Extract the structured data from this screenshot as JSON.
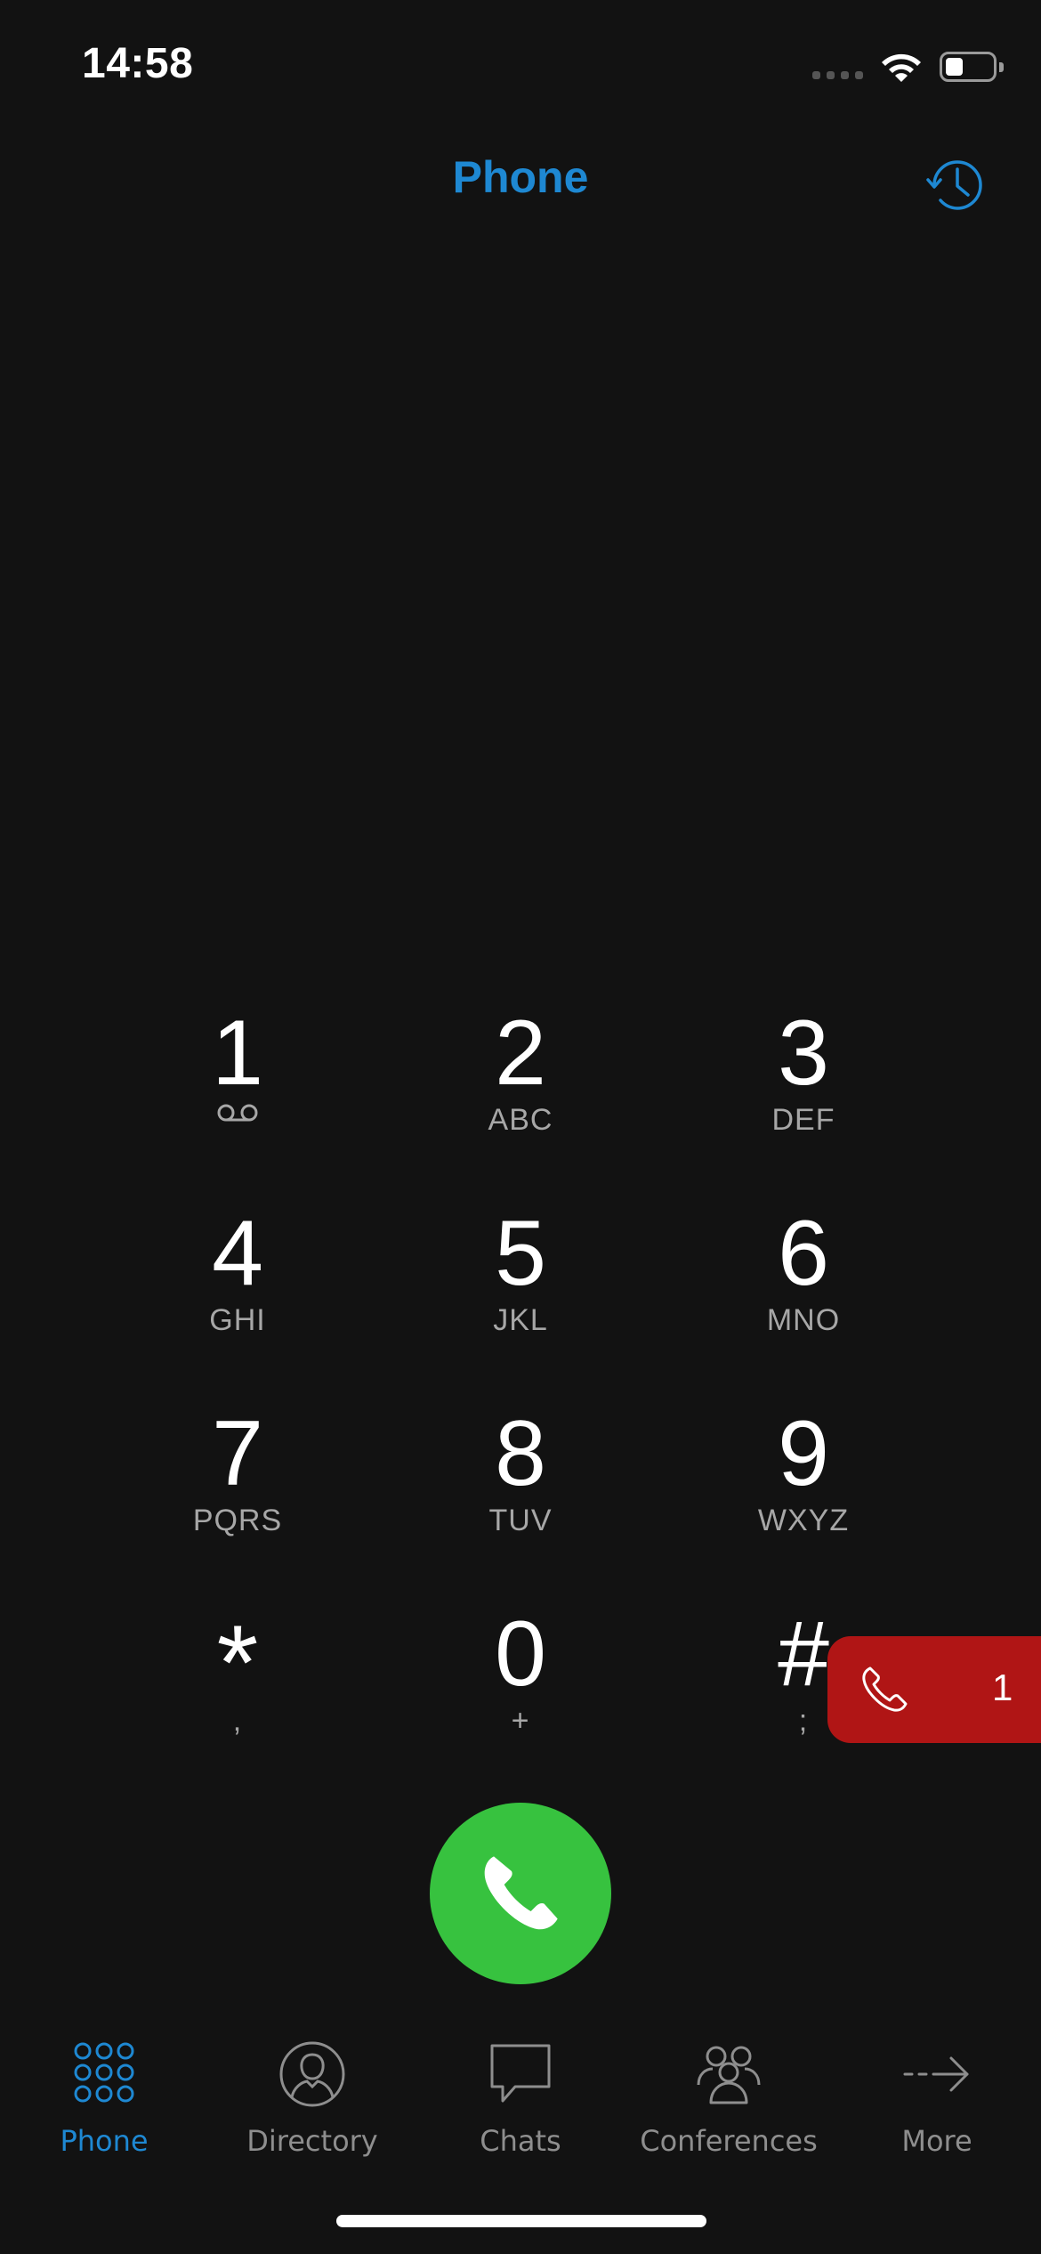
{
  "status_bar": {
    "time": "14:58"
  },
  "header": {
    "title": "Phone"
  },
  "keypad": [
    {
      "digit": "1",
      "sub": ""
    },
    {
      "digit": "2",
      "sub": "ABC"
    },
    {
      "digit": "3",
      "sub": "DEF"
    },
    {
      "digit": "4",
      "sub": "GHI"
    },
    {
      "digit": "5",
      "sub": "JKL"
    },
    {
      "digit": "6",
      "sub": "MNO"
    },
    {
      "digit": "7",
      "sub": "PQRS"
    },
    {
      "digit": "8",
      "sub": "TUV"
    },
    {
      "digit": "9",
      "sub": "WXYZ"
    },
    {
      "digit": "*",
      "sub": ","
    },
    {
      "digit": "0",
      "sub": "+"
    },
    {
      "digit": "#",
      "sub": ";"
    }
  ],
  "active_call": {
    "count": "1"
  },
  "tabs": [
    {
      "label": "Phone",
      "icon": "keypad-icon",
      "active": true
    },
    {
      "label": "Directory",
      "icon": "person-icon",
      "active": false
    },
    {
      "label": "Chats",
      "icon": "chat-bubble-icon",
      "active": false
    },
    {
      "label": "Conferences",
      "icon": "group-icon",
      "active": false
    },
    {
      "label": "More",
      "icon": "arrow-right-icon",
      "active": false
    }
  ],
  "colors": {
    "accent": "#1e88d2",
    "call_green": "#37c23f",
    "active_call_red": "#b01515",
    "background": "#121212"
  }
}
